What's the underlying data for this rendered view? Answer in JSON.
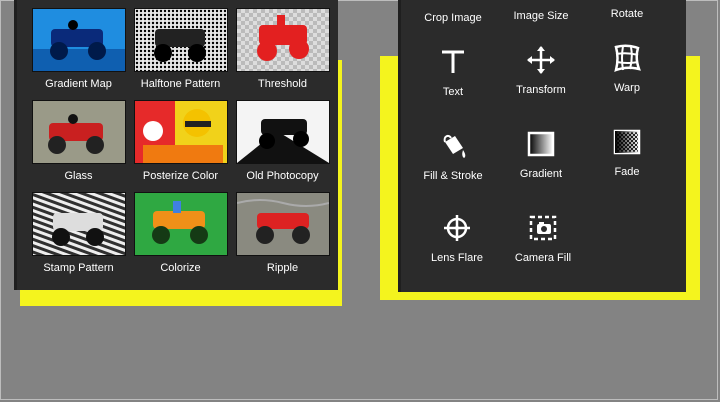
{
  "effects": [
    {
      "label": "Gradient Map",
      "icon": "gradient-map-thumb"
    },
    {
      "label": "Halftone Pattern",
      "icon": "halftone-pattern-thumb"
    },
    {
      "label": "Threshold",
      "icon": "threshold-thumb"
    },
    {
      "label": "Glass",
      "icon": "glass-thumb"
    },
    {
      "label": "Posterize Color",
      "icon": "posterize-color-thumb"
    },
    {
      "label": "Old Photocopy",
      "icon": "old-photocopy-thumb"
    },
    {
      "label": "Stamp Pattern",
      "icon": "stamp-pattern-thumb"
    },
    {
      "label": "Colorize",
      "icon": "colorize-thumb"
    },
    {
      "label": "Ripple",
      "icon": "ripple-thumb"
    }
  ],
  "tools": [
    {
      "label": "Crop Image",
      "icon": "crop-icon"
    },
    {
      "label": "Image Size",
      "icon": "image-size-icon"
    },
    {
      "label": "Rotate",
      "icon": "rotate-icon"
    },
    {
      "label": "Text",
      "icon": "text-icon"
    },
    {
      "label": "Transform",
      "icon": "move-arrows-icon"
    },
    {
      "label": "Warp",
      "icon": "warp-grid-icon"
    },
    {
      "label": "Fill & Stroke",
      "icon": "paint-bucket-icon"
    },
    {
      "label": "Gradient",
      "icon": "gradient-icon"
    },
    {
      "label": "Fade",
      "icon": "fade-icon"
    },
    {
      "label": "Lens Flare",
      "icon": "lens-flare-icon"
    },
    {
      "label": "Camera Fill",
      "icon": "camera-fill-icon"
    }
  ],
  "colors": {
    "panel": "#2b2b2b",
    "highlight": "#f4f41e",
    "background": "#838383",
    "label": "#ffffff"
  }
}
